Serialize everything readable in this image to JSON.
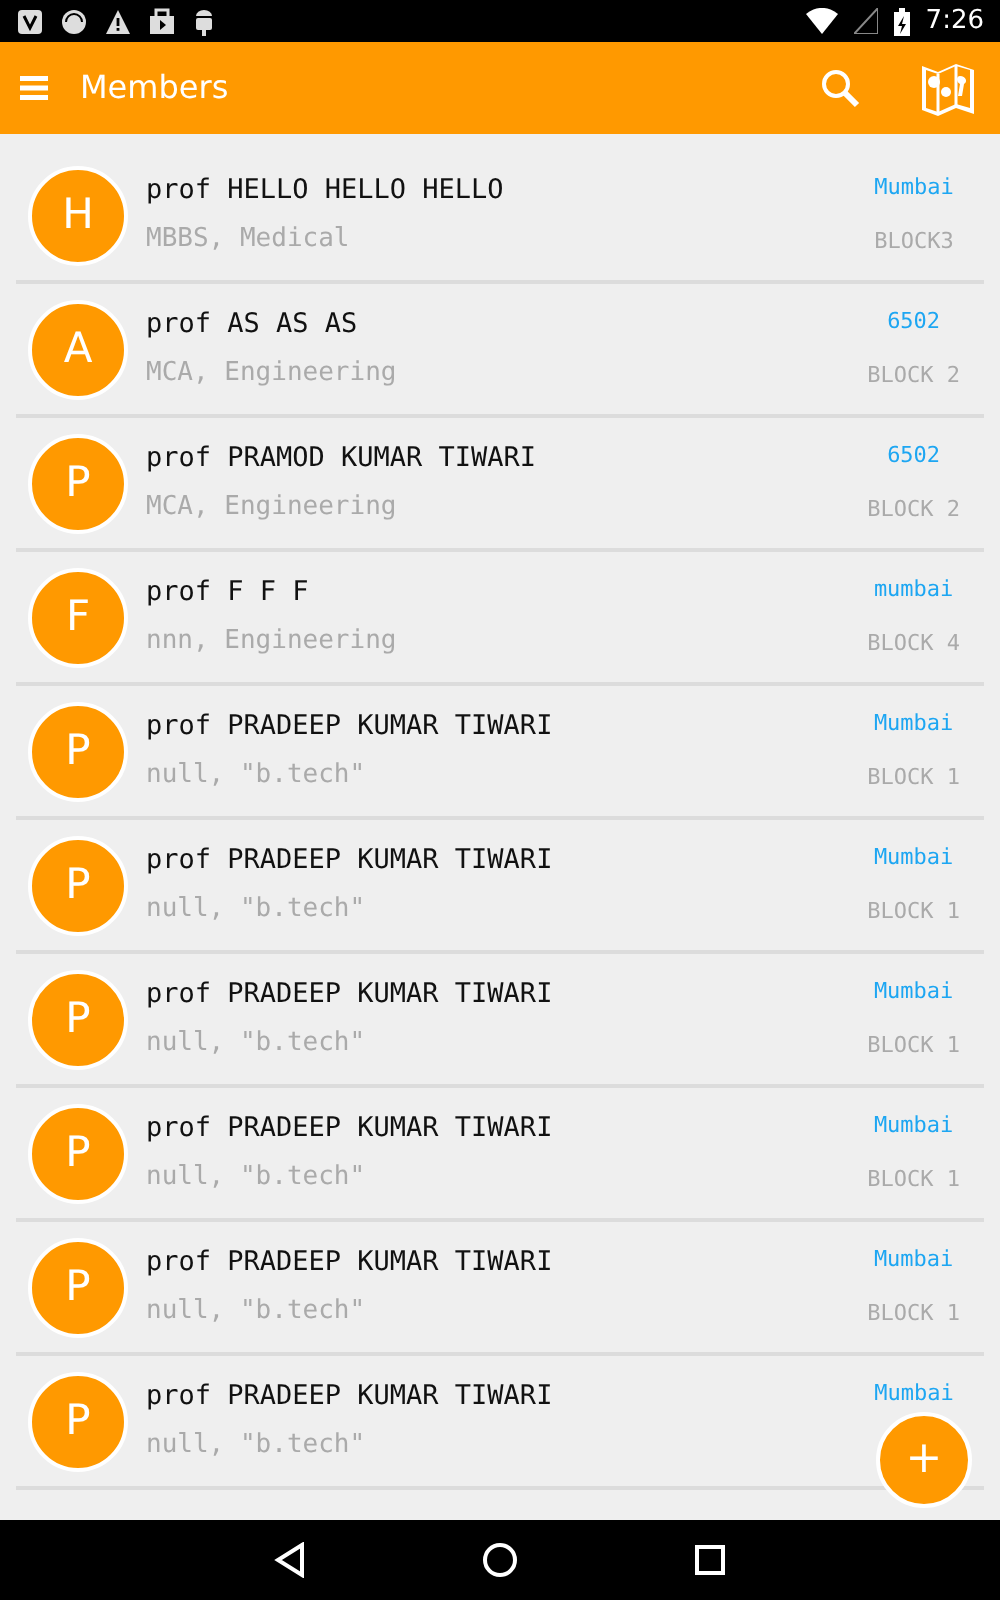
{
  "status_bar": {
    "time": "7:26"
  },
  "app_bar": {
    "title": "Members"
  },
  "members": [
    {
      "initial": "H",
      "name": "prof HELLO HELLO HELLO",
      "subtitle": "MBBS, Medical",
      "city": "Mumbai",
      "block": "BLOCK3"
    },
    {
      "initial": "A",
      "name": "prof AS AS AS",
      "subtitle": "MCA, Engineering",
      "city": "6502",
      "block": "BLOCK 2"
    },
    {
      "initial": "P",
      "name": "prof PRAMOD KUMAR TIWARI",
      "subtitle": "MCA, Engineering",
      "city": "6502",
      "block": "BLOCK 2"
    },
    {
      "initial": "F",
      "name": "prof F F F",
      "subtitle": "nnn, Engineering",
      "city": "mumbai",
      "block": "BLOCK 4"
    },
    {
      "initial": "P",
      "name": "prof PRADEEP KUMAR TIWARI",
      "subtitle": "null, \"b.tech\"",
      "city": "Mumbai",
      "block": "BLOCK 1"
    },
    {
      "initial": "P",
      "name": "prof PRADEEP KUMAR TIWARI",
      "subtitle": "null, \"b.tech\"",
      "city": "Mumbai",
      "block": "BLOCK 1"
    },
    {
      "initial": "P",
      "name": "prof PRADEEP KUMAR TIWARI",
      "subtitle": "null, \"b.tech\"",
      "city": "Mumbai",
      "block": "BLOCK 1"
    },
    {
      "initial": "P",
      "name": "prof PRADEEP KUMAR TIWARI",
      "subtitle": "null, \"b.tech\"",
      "city": "Mumbai",
      "block": "BLOCK 1"
    },
    {
      "initial": "P",
      "name": "prof PRADEEP KUMAR TIWARI",
      "subtitle": "null, \"b.tech\"",
      "city": "Mumbai",
      "block": "BLOCK 1"
    },
    {
      "initial": "P",
      "name": "prof PRADEEP KUMAR TIWARI",
      "subtitle": "null, \"b.tech\"",
      "city": "Mumbai"
    }
  ],
  "fab": {
    "label": "+"
  }
}
